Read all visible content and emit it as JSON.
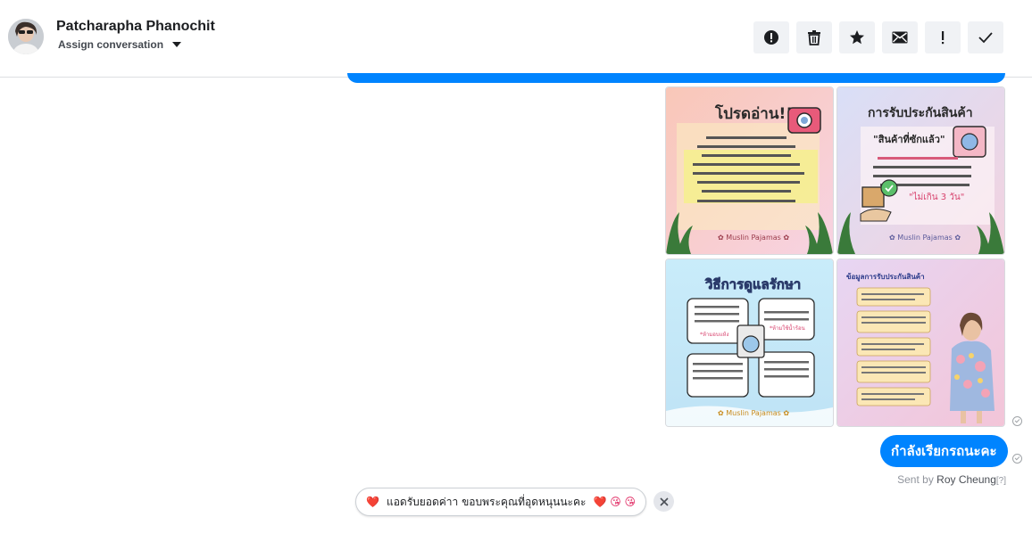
{
  "header": {
    "contact_name": "Patcharapha Phanochit",
    "assign_label": "Assign conversation",
    "toolbar": [
      {
        "icon": "alert-circle-icon",
        "label": ""
      },
      {
        "icon": "trash-icon",
        "label": ""
      },
      {
        "icon": "star-icon",
        "label": ""
      },
      {
        "icon": "envelope-icon",
        "label": ""
      },
      {
        "icon": "exclamation-icon",
        "label": ""
      },
      {
        "icon": "check-icon",
        "label": ""
      }
    ]
  },
  "images": {
    "tile1": {
      "title": "โปรดอ่าน!!",
      "footer": "✿ Muslin Pajamas ✿"
    },
    "tile2": {
      "title": "การรับประกันสินค้า",
      "footer": "✿ Muslin Pajamas ✿",
      "subtitle": "\"สินค้าที่ซักแล้ว\"",
      "highlight": "\"ไม่เกิน 3 วัน\""
    },
    "tile3": {
      "title": "วิธีการดูแลรักษา",
      "footer": "✿ Muslin Pajamas ✿",
      "note1": "*ห้ามอบแห้ง",
      "note2": "*ห้ามใช้น้ำร้อน"
    },
    "tile4": {
      "title": "ข้อมูลการรับประกันสินค้า"
    }
  },
  "message": {
    "text": "กำลังเรียกรถนะคะ",
    "sent_by_prefix": "Sent by ",
    "sent_by_name": "Roy Cheung",
    "sent_by_help": "[?]"
  },
  "quick_reply": {
    "text": "แอดรับยอดค่าา ขอบพระคุณที่อุดหนุนนะคะ",
    "leading_emoji": "❤️",
    "trailing_emoji": "❤️ 😘 😘"
  },
  "colors": {
    "brand_blue": "#0084ff",
    "toolbar_bg": "#f0f2f5"
  }
}
